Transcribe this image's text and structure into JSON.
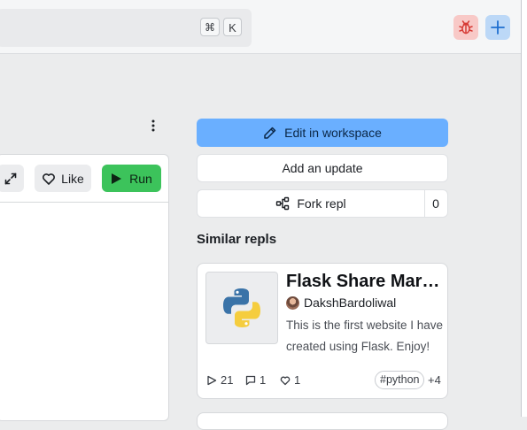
{
  "search": {
    "shortcut_cmd": "⌘",
    "shortcut_key": "K"
  },
  "repl_toolbar": {
    "like_label": "Like",
    "run_label": "Run"
  },
  "actions": {
    "edit_label": "Edit in workspace",
    "update_label": "Add an update",
    "fork_label": "Fork repl",
    "fork_count": "0"
  },
  "similar": {
    "title": "Similar repls",
    "cards": [
      {
        "title": "Flask Share Marketplace",
        "author": "DakshBardoliwal",
        "description": "This is the first website I have created using Flask. Enjoy!",
        "runs": "21",
        "comments": "1",
        "likes": "1",
        "tag": "#python",
        "more_tags": "+4"
      }
    ]
  },
  "icons": {
    "report_bug": "bug-icon",
    "create": "plus-icon",
    "more": "kebab-icon",
    "expand": "expand-icon",
    "like": "heart-icon",
    "run": "play-icon",
    "edit": "pencil-icon",
    "fork": "fork-icon",
    "language": "python-logo-icon"
  },
  "colors": {
    "edit_button": "#6aafff",
    "run_button": "#3cc35b",
    "bug_button": "#f8c9c7",
    "plus_button": "#bcd8f7"
  }
}
